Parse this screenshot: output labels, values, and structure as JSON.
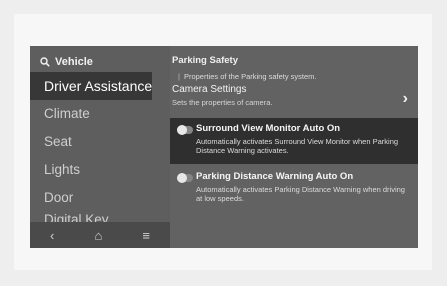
{
  "sidebar": {
    "header": "Vehicle",
    "items": [
      {
        "label": "Driver Assistance"
      },
      {
        "label": "Climate"
      },
      {
        "label": "Seat"
      },
      {
        "label": "Lights"
      },
      {
        "label": "Door"
      },
      {
        "label": "Digital Key"
      }
    ],
    "bottom": {
      "back_icon": "back-chevron-icon",
      "home_icon": "home-icon",
      "menu_icon": "menu-icon"
    }
  },
  "main": {
    "section_title": "Parking Safety",
    "section_note": "Properties of the Parking safety system.",
    "camera": {
      "title": "Camera Settings",
      "desc": "Sets the properties of camera."
    },
    "options": [
      {
        "title": "Surround View Monitor Auto On",
        "desc": "Automatically activates Surround View Monitor when Parking Distance Warning activates."
      },
      {
        "title": "Parking Distance Warning Auto On",
        "desc": "Automatically activates Parking Distance Warning when driving at low speeds."
      }
    ]
  }
}
